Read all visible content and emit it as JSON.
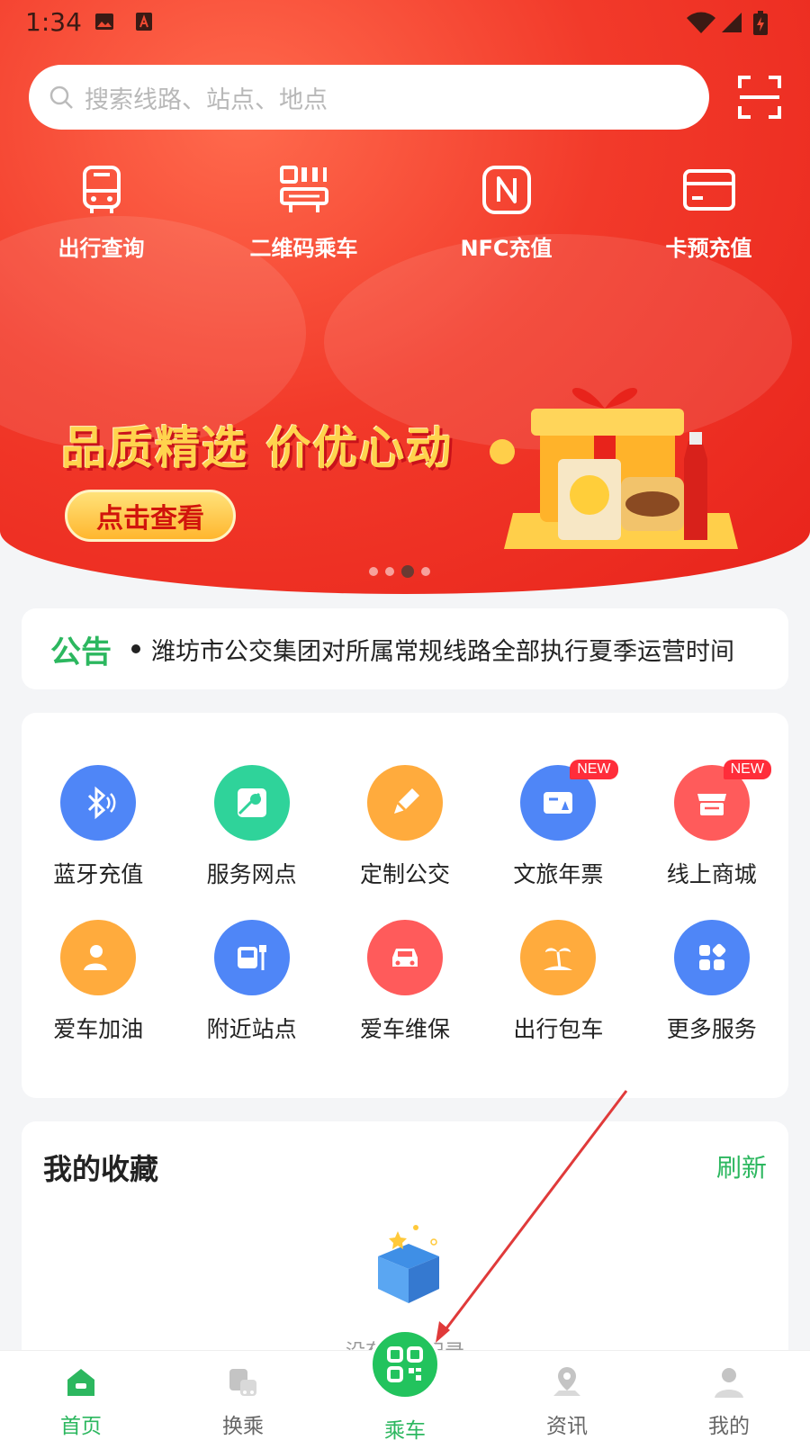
{
  "status": {
    "time": "1:34"
  },
  "search": {
    "placeholder": "搜索线路、站点、地点"
  },
  "quick": [
    {
      "label": "出行查询",
      "icon": "bus-icon"
    },
    {
      "label": "二维码乘车",
      "icon": "qr-ride-icon"
    },
    {
      "label": "NFC充值",
      "icon": "nfc-icon"
    },
    {
      "label": "卡预充值",
      "icon": "card-icon"
    }
  ],
  "banner": {
    "headline": "品质精选 价优心动",
    "cta": "点击查看",
    "page_index": 3,
    "page_count": 4
  },
  "notice": {
    "tag": "公告",
    "text": "潍坊市公交集团对所属常规线路全部执行夏季运营时间"
  },
  "services": [
    {
      "label": "蓝牙充值",
      "icon": "bluetooth-icon",
      "color": "#4f86f7"
    },
    {
      "label": "服务网点",
      "icon": "map-pin-icon",
      "color": "#2fd39a"
    },
    {
      "label": "定制公交",
      "icon": "pencil-icon",
      "color": "#ffab3d"
    },
    {
      "label": "文旅年票",
      "icon": "ticket-icon",
      "color": "#4f86f7",
      "badge": "NEW"
    },
    {
      "label": "线上商城",
      "icon": "store-icon",
      "color": "#ff5b5b",
      "badge": "NEW"
    },
    {
      "label": "爱车加油",
      "icon": "fuel-user-icon",
      "color": "#ffab3d"
    },
    {
      "label": "附近站点",
      "icon": "bus-stop-icon",
      "color": "#4f86f7"
    },
    {
      "label": "爱车维保",
      "icon": "car-icon",
      "color": "#ff5b5b"
    },
    {
      "label": "出行包车",
      "icon": "palm-tree-icon",
      "color": "#ffab3d"
    },
    {
      "label": "更多服务",
      "icon": "grid-icon",
      "color": "#4f86f7"
    }
  ],
  "favorites": {
    "title": "我的收藏",
    "refresh": "刷新",
    "empty": "没有收藏记录"
  },
  "tabs": [
    {
      "label": "首页",
      "icon": "home-icon"
    },
    {
      "label": "换乘",
      "icon": "transfer-icon"
    },
    {
      "label": "乘车",
      "icon": "qr-code-icon"
    },
    {
      "label": "资讯",
      "icon": "news-icon"
    },
    {
      "label": "我的",
      "icon": "user-icon"
    }
  ],
  "colors": {
    "brand_red": "#e8231b",
    "accent_green": "#2cb75f"
  }
}
